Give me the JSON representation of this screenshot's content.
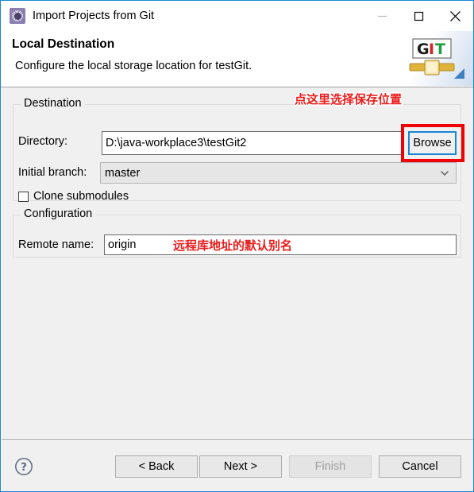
{
  "window": {
    "title": "Import Projects from Git",
    "icon": "eclipse-wizard-icon",
    "controls": {
      "minimize": "minimize-icon",
      "maximize": "maximize-icon",
      "close": "close-icon"
    }
  },
  "header": {
    "title": "Local Destination",
    "description": "Configure the local storage location for testGit.",
    "logo": {
      "letters": [
        "G",
        "I",
        "T"
      ],
      "colors": [
        "#1a1a1a",
        "#d81f1f",
        "#1b9e3f"
      ]
    }
  },
  "destination": {
    "group_label": "Destination",
    "directory_label": "Directory:",
    "directory_value": "D:\\java-workplace3\\testGit2",
    "browse_label": "Browse",
    "initial_branch_label": "Initial branch:",
    "initial_branch_value": "master",
    "initial_branch_options": [
      "master"
    ],
    "clone_submodules_label": "Clone submodules",
    "clone_submodules_checked": false
  },
  "configuration": {
    "group_label": "Configuration",
    "remote_name_label": "Remote name:",
    "remote_name_value": "origin"
  },
  "annotations": [
    {
      "text": "点这里选择保存位置",
      "color": "#ec1c1c"
    },
    {
      "text": "远程库地址的默认别名",
      "color": "#ec1c1c"
    }
  ],
  "footer": {
    "help_icon": "help-circle-icon",
    "back_label": "< Back",
    "next_label": "Next >",
    "finish_label": "Finish",
    "finish_disabled": true,
    "cancel_label": "Cancel"
  },
  "colors": {
    "window_border": "#1b86d3",
    "focus_border": "#1b86d3",
    "highlight_red": "#f00000",
    "content_bg": "#f0f0f0"
  }
}
